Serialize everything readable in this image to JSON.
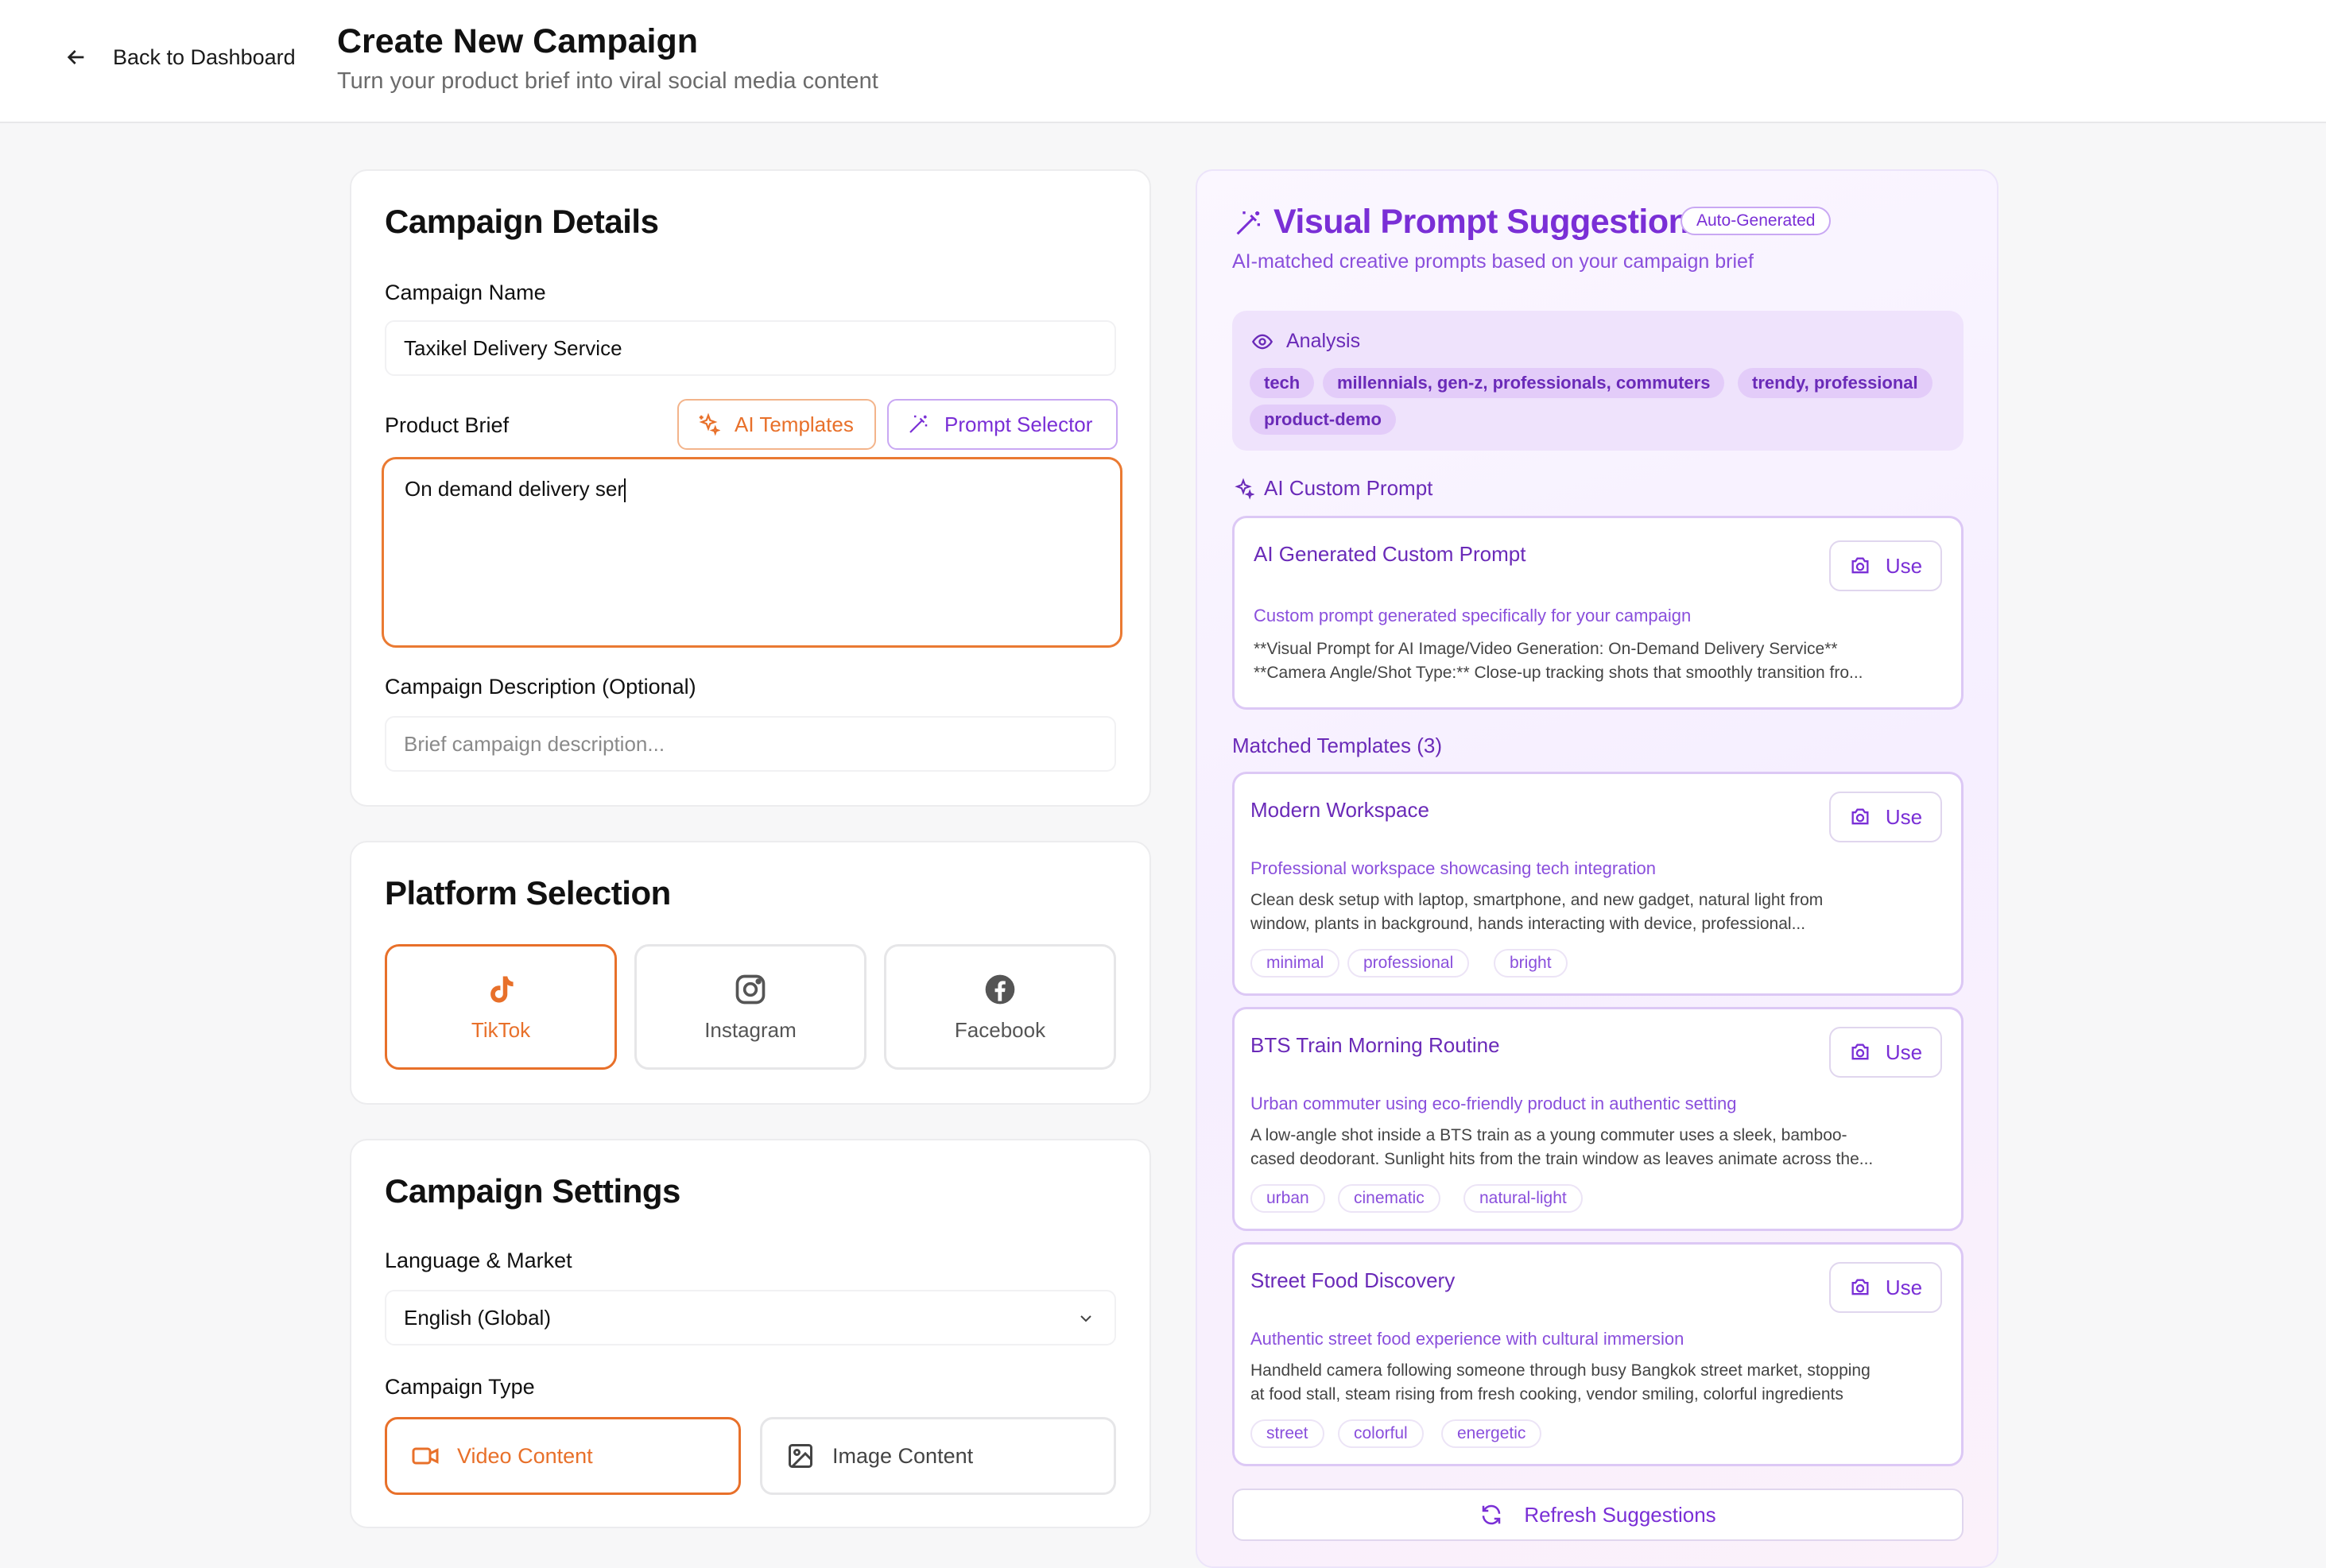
{
  "header": {
    "back_label": "Back to Dashboard",
    "title": "Create New Campaign",
    "subtitle": "Turn your product brief into viral social media content"
  },
  "campaign_details": {
    "title": "Campaign Details",
    "name_label": "Campaign Name",
    "name_value": "Taxikel Delivery Service",
    "brief_label": "Product Brief",
    "ai_templates_label": "AI Templates",
    "prompt_selector_label": "Prompt Selector",
    "brief_value": "On demand delivery ser",
    "description_label": "Campaign Description (Optional)",
    "description_placeholder": "Brief campaign description..."
  },
  "platform_selection": {
    "title": "Platform Selection",
    "platforms": [
      {
        "label": "TikTok",
        "icon": "tiktok-icon",
        "selected": true
      },
      {
        "label": "Instagram",
        "icon": "instagram-icon",
        "selected": false
      },
      {
        "label": "Facebook",
        "icon": "facebook-icon",
        "selected": false
      }
    ]
  },
  "campaign_settings": {
    "title": "Campaign Settings",
    "language_label": "Language & Market",
    "language_value": "English (Global)",
    "type_label": "Campaign Type",
    "types": [
      {
        "label": "Video Content",
        "icon": "video-icon",
        "selected": true
      },
      {
        "label": "Image Content",
        "icon": "image-icon",
        "selected": false
      }
    ]
  },
  "suggestions": {
    "title": "Visual Prompt Suggestions",
    "badge": "Auto-Generated",
    "subtitle": "AI-matched creative prompts based on your campaign brief",
    "analysis_label": "Analysis",
    "analysis_chips": [
      "tech",
      "millennials, gen-z, professionals, commuters",
      "trendy, professional",
      "product-demo"
    ],
    "custom_prompt_label": "AI Custom Prompt",
    "custom_prompt": {
      "title": "AI Generated Custom Prompt",
      "description": "Custom prompt generated specifically for your campaign",
      "body_line1": "**Visual Prompt for AI Image/Video Generation: On-Demand Delivery Service**",
      "body_line2": "**Camera Angle/Shot Type:** Close-up tracking shots that smoothly transition fro...",
      "use_label": "Use"
    },
    "matched_label": "Matched Templates (3)",
    "templates": [
      {
        "title": "Modern Workspace",
        "description": "Professional workspace showcasing tech integration",
        "body_line1": "Clean desk setup with laptop, smartphone, and new gadget, natural light from",
        "body_line2": "window, plants in background, hands interacting with device, professional...",
        "tags": [
          "minimal",
          "professional",
          "bright"
        ],
        "use_label": "Use"
      },
      {
        "title": "BTS Train Morning Routine",
        "description": "Urban commuter using eco-friendly product in authentic setting",
        "body_line1": "A low-angle shot inside a BTS train as a young commuter uses a sleek, bamboo-",
        "body_line2": "cased deodorant. Sunlight hits from the train window as leaves animate across the...",
        "tags": [
          "urban",
          "cinematic",
          "natural-light"
        ],
        "use_label": "Use"
      },
      {
        "title": "Street Food Discovery",
        "description": "Authentic street food experience with cultural immersion",
        "body_line1": "Handheld camera following someone through busy Bangkok street market, stopping",
        "body_line2": "at food stall, steam rising from fresh cooking, vendor smiling, colorful ingredients",
        "tags": [
          "street",
          "colorful",
          "energetic"
        ],
        "use_label": "Use"
      }
    ],
    "refresh_label": "Refresh Suggestions"
  },
  "colors": {
    "accent_orange": "#e8702a",
    "accent_purple": "#7a2fd6"
  }
}
